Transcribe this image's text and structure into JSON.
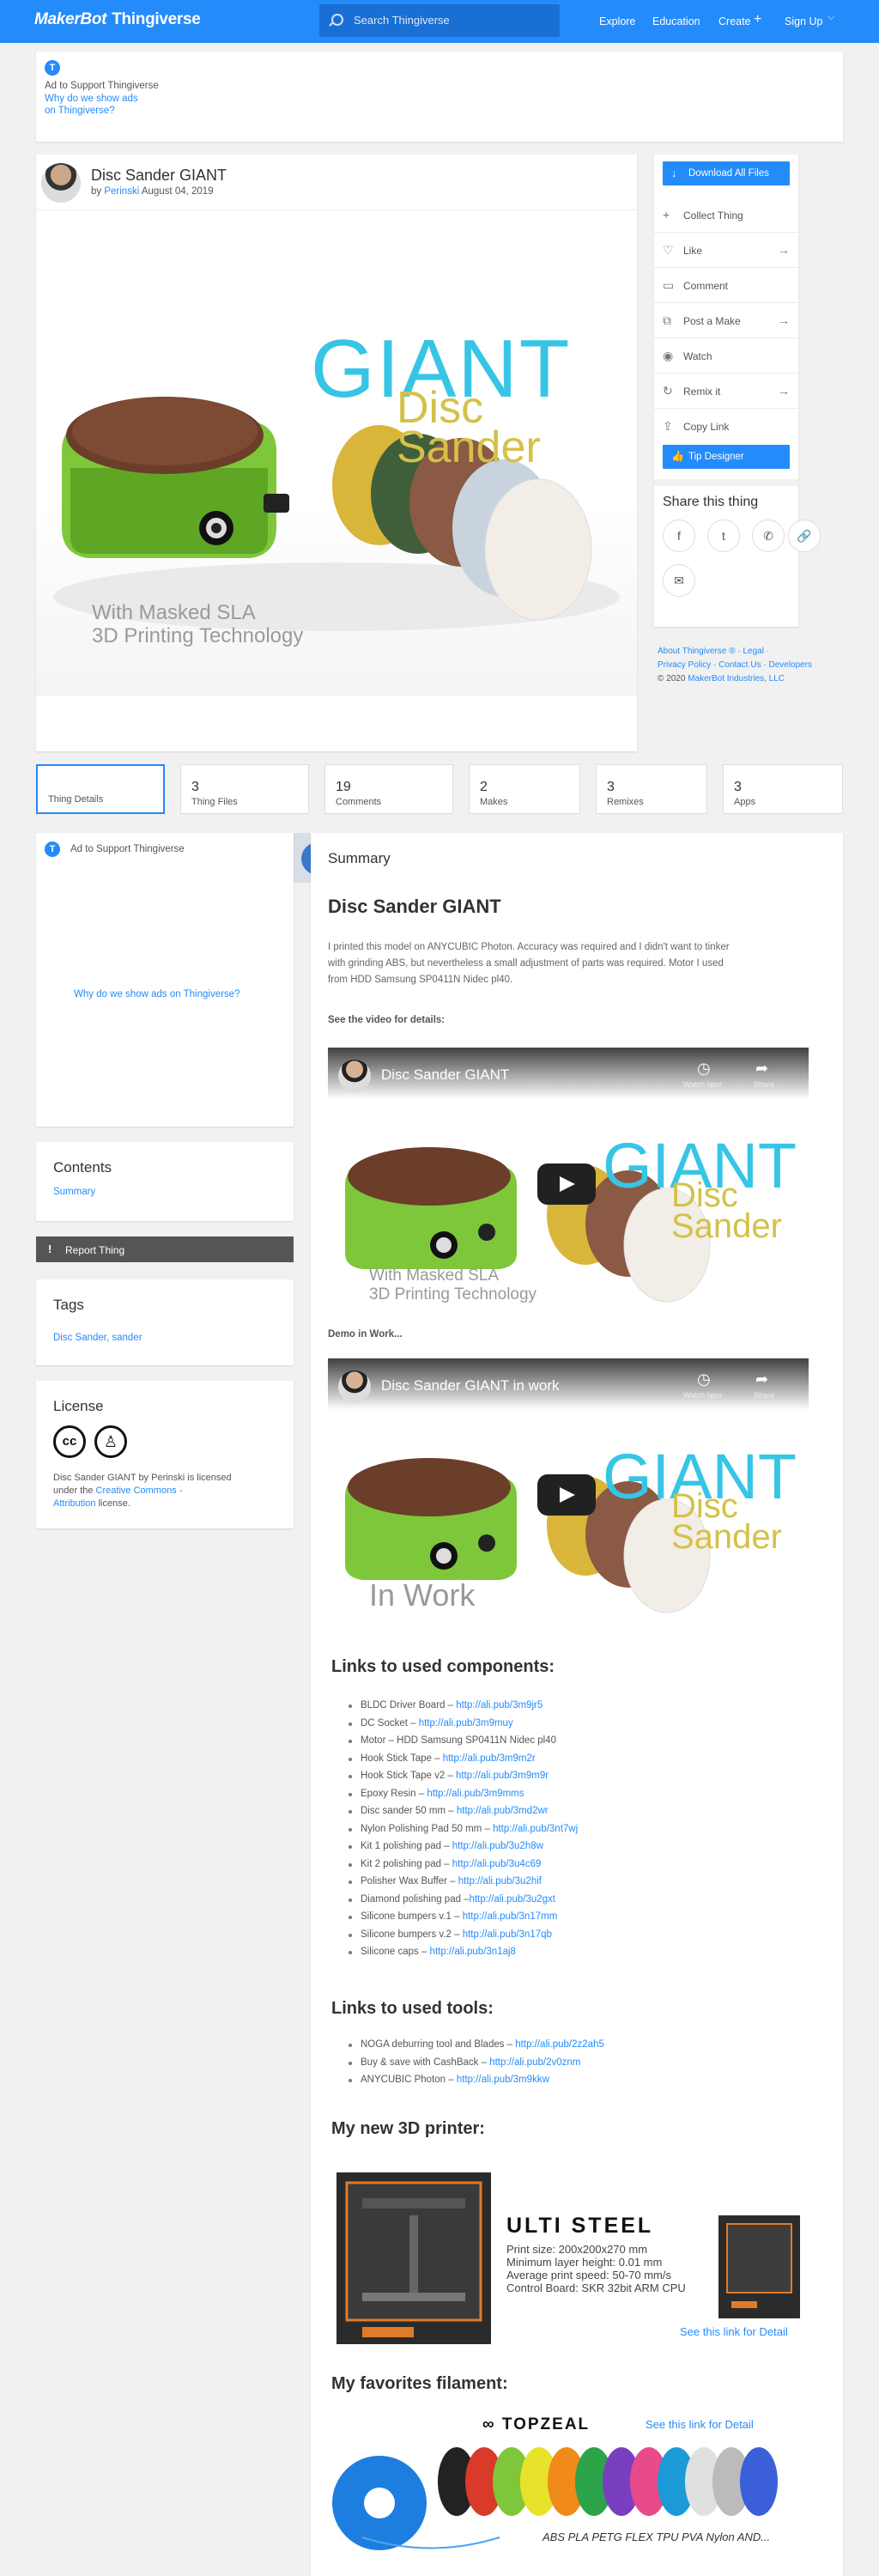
{
  "header": {
    "logo_brand": "MakerBot",
    "logo_product": "Thingiverse",
    "search_placeholder": "Search Thingiverse",
    "nav": [
      "Explore",
      "Education",
      "Create",
      "Sign Up"
    ]
  },
  "top_ad": {
    "label": "Ad to Support Thingiverse",
    "why_line1": "Why do we show ads",
    "why_line2": "on Thingiverse?"
  },
  "thing": {
    "title": "Disc Sander GIANT",
    "by": "by",
    "author": "Perinski",
    "date": "August 04, 2019",
    "hero": {
      "giant": "GIANT",
      "disc": "Disc",
      "sander": "Sander",
      "caption_1": "With Masked SLA",
      "caption_2": "3D Printing Technology"
    },
    "thumbnails": 5
  },
  "actions": {
    "download": "Download All Files",
    "items": [
      "Collect Thing",
      "Like",
      "Comment",
      "Post a Make",
      "Watch",
      "Remix it",
      "Copy Link"
    ],
    "tip": "Tip Designer",
    "share_title": "Share this thing"
  },
  "footer_links": {
    "line1": "About Thingiverse ® · Legal ·",
    "line2": "Privacy Policy · Contact Us · Developers",
    "copyright": "© 2020",
    "company": "MakerBot Industries, LLC"
  },
  "tabs": [
    {
      "number": "",
      "label": "Thing Details"
    },
    {
      "number": "3",
      "label": "Thing Files"
    },
    {
      "number": "19",
      "label": "Comments"
    },
    {
      "number": "2",
      "label": "Makes"
    },
    {
      "number": "3",
      "label": "Remixes"
    },
    {
      "number": "3",
      "label": "Apps"
    }
  ],
  "sidebar": {
    "ad_label": "Ad to Support Thingiverse",
    "ad_why": "Why do we show ads on Thingiverse?",
    "contents_title": "Contents",
    "contents_item": "Summary",
    "report": "Report Thing",
    "tags_title": "Tags",
    "tags": "Disc Sander, sander",
    "license_title": "License",
    "license_text_1": "Disc Sander GIANT by Perinski is licensed",
    "license_text_2": "under the",
    "license_link_1": "Creative Commons -",
    "license_link_2": "Attribution",
    "license_text_3": "license."
  },
  "summary": {
    "section_title": "Summary",
    "title": "Disc Sander GIANT",
    "para_1": "I printed this model on ANYCUBIC Photon. Accuracy was required and I didn't want to tinker",
    "para_2": "with grinding ABS, but nevertheless a small adjustment of parts was required. Motor I used",
    "para_3": "from HDD Samsung SP0411N Nidec pl40.",
    "video_label": "See the video for details:",
    "video_1_title": "Disc Sander GIANT",
    "video_overlay_1": "Watch later",
    "video_overlay_2": "Share",
    "demo_label": "Demo in Work...",
    "video_2_title": "Disc Sander GIANT in work",
    "video_2_caption": "In Work",
    "components_title": "Links to used components:",
    "components": [
      {
        "name": "BLDC Driver Board – ",
        "url": "http://ali.pub/3m9jr5"
      },
      {
        "name": "DC Socket – ",
        "url": "http://ali.pub/3m9muy"
      },
      {
        "name": "Motor – HDD Samsung SP0411N Nidec pl40",
        "url": ""
      },
      {
        "name": "Hook Stick Tape – ",
        "url": "http://ali.pub/3m9m2r"
      },
      {
        "name": "Hook Stick Tape v2 – ",
        "url": "http://ali.pub/3m9m9r"
      },
      {
        "name": "Epoxy Resin – ",
        "url": "http://ali.pub/3m9mms"
      },
      {
        "name": "Disc sander 50 mm – ",
        "url": "http://ali.pub/3md2wr"
      },
      {
        "name": "Nylon Polishing Pad 50 mm – ",
        "url": "http://ali.pub/3nt7wj"
      },
      {
        "name": "Kit 1 polishing pad – ",
        "url": "http://ali.pub/3u2h8w"
      },
      {
        "name": "Kit 2 polishing pad – ",
        "url": "http://ali.pub/3u4c69"
      },
      {
        "name": "Polisher Wax Buffer – ",
        "url": "http://ali.pub/3u2hif"
      },
      {
        "name": "Diamond polishing pad –",
        "url": "http://ali.pub/3u2gxt"
      },
      {
        "name": "Silicone bumpers v.1 – ",
        "url": "http://ali.pub/3n17mm"
      },
      {
        "name": "Silicone bumpers v.2 – ",
        "url": "http://ali.pub/3n17qb"
      },
      {
        "name": "Silicone caps – ",
        "url": "http://ali.pub/3n1aj8"
      }
    ],
    "tools_title": "Links to used tools:",
    "tools": [
      {
        "name": "NOGA deburring tool and Blades – ",
        "url": "http://ali.pub/2z2ah5"
      },
      {
        "name": "Buy & save with CashBack – ",
        "url": "http://ali.pub/2v0znm"
      },
      {
        "name": "ANYCUBIC Photon – ",
        "url": "http://ali.pub/3m9kkw"
      }
    ],
    "printer_title": "My new 3D printer:",
    "printer": {
      "name": "ULTI STEEL",
      "spec_1": "Print size: 200x200x270 mm",
      "spec_2": "Minimum layer height: 0.01 mm",
      "spec_3": "Average print speed: 50-70 mm/s",
      "spec_4": "Control Board: SKR 32bit ARM CPU",
      "link": "See this link for Detail"
    },
    "filament_title": "My favorites filament:",
    "filament": {
      "brand": "TOPZEAL",
      "link": "See this link for Detail",
      "types": "ABS PLA PETG FLEX TPU PVA Nylon AND..."
    }
  },
  "colors": {
    "accent": "#248bfb",
    "background": "#f1f1f1"
  }
}
